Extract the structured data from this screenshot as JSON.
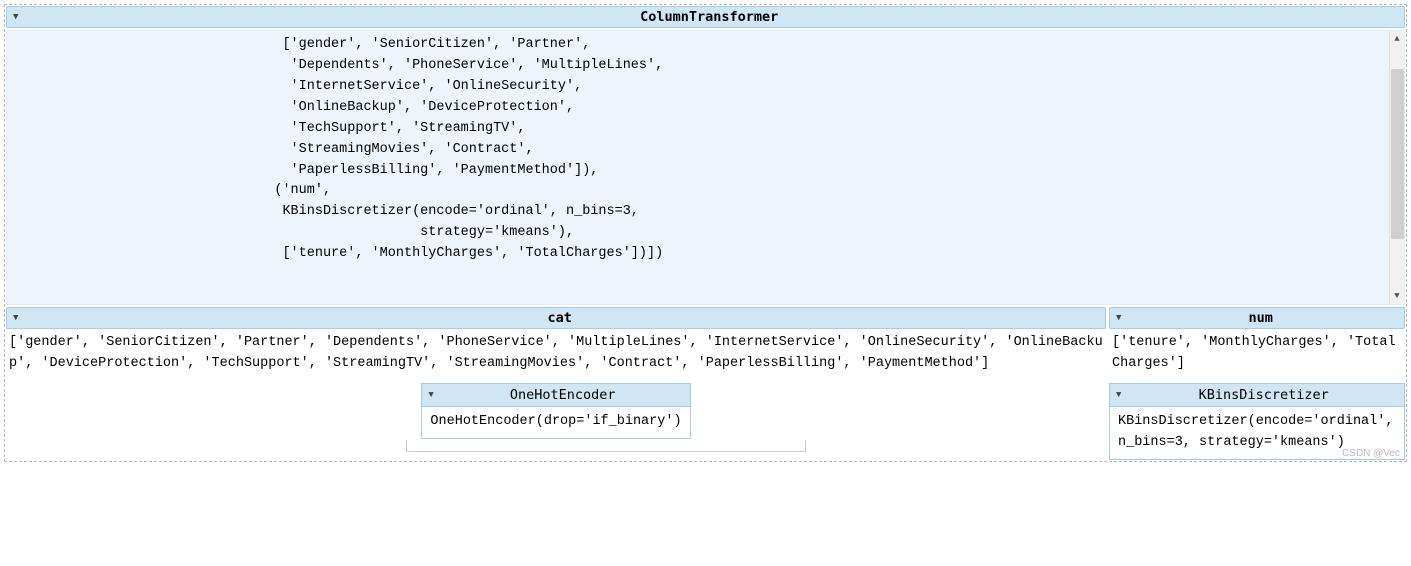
{
  "main_header": "ColumnTransformer",
  "code_block": "                                  ['gender', 'SeniorCitizen', 'Partner',\n                                   'Dependents', 'PhoneService', 'MultipleLines',\n                                   'InternetService', 'OnlineSecurity',\n                                   'OnlineBackup', 'DeviceProtection',\n                                   'TechSupport', 'StreamingTV',\n                                   'StreamingMovies', 'Contract',\n                                   'PaperlessBilling', 'PaymentMethod']),\n                                 ('num',\n                                  KBinsDiscretizer(encode='ordinal', n_bins=3,\n                                                   strategy='kmeans'),\n                                  ['tenure', 'MonthlyCharges', 'TotalCharges'])])",
  "cat": {
    "header": "cat",
    "columns_text": "['gender', 'SeniorCitizen', 'Partner', 'Dependents', 'PhoneService', 'MultipleLines', 'InternetService', 'OnlineSecurity', 'OnlineBackup', 'DeviceProtection', 'TechSupport', 'StreamingTV', 'StreamingMovies', 'Contract', 'PaperlessBilling', 'PaymentMethod']",
    "estimator_name": "OneHotEncoder",
    "estimator_repr": "OneHotEncoder(drop='if_binary')"
  },
  "num": {
    "header": "num",
    "columns_text": "['tenure', 'MonthlyCharges', 'TotalCharges']",
    "estimator_name": "KBinsDiscretizer",
    "estimator_repr": "KBinsDiscretizer(encode='ordinal', n_bins=3, strategy='kmeans')"
  },
  "watermark": "CSDN @Vec"
}
